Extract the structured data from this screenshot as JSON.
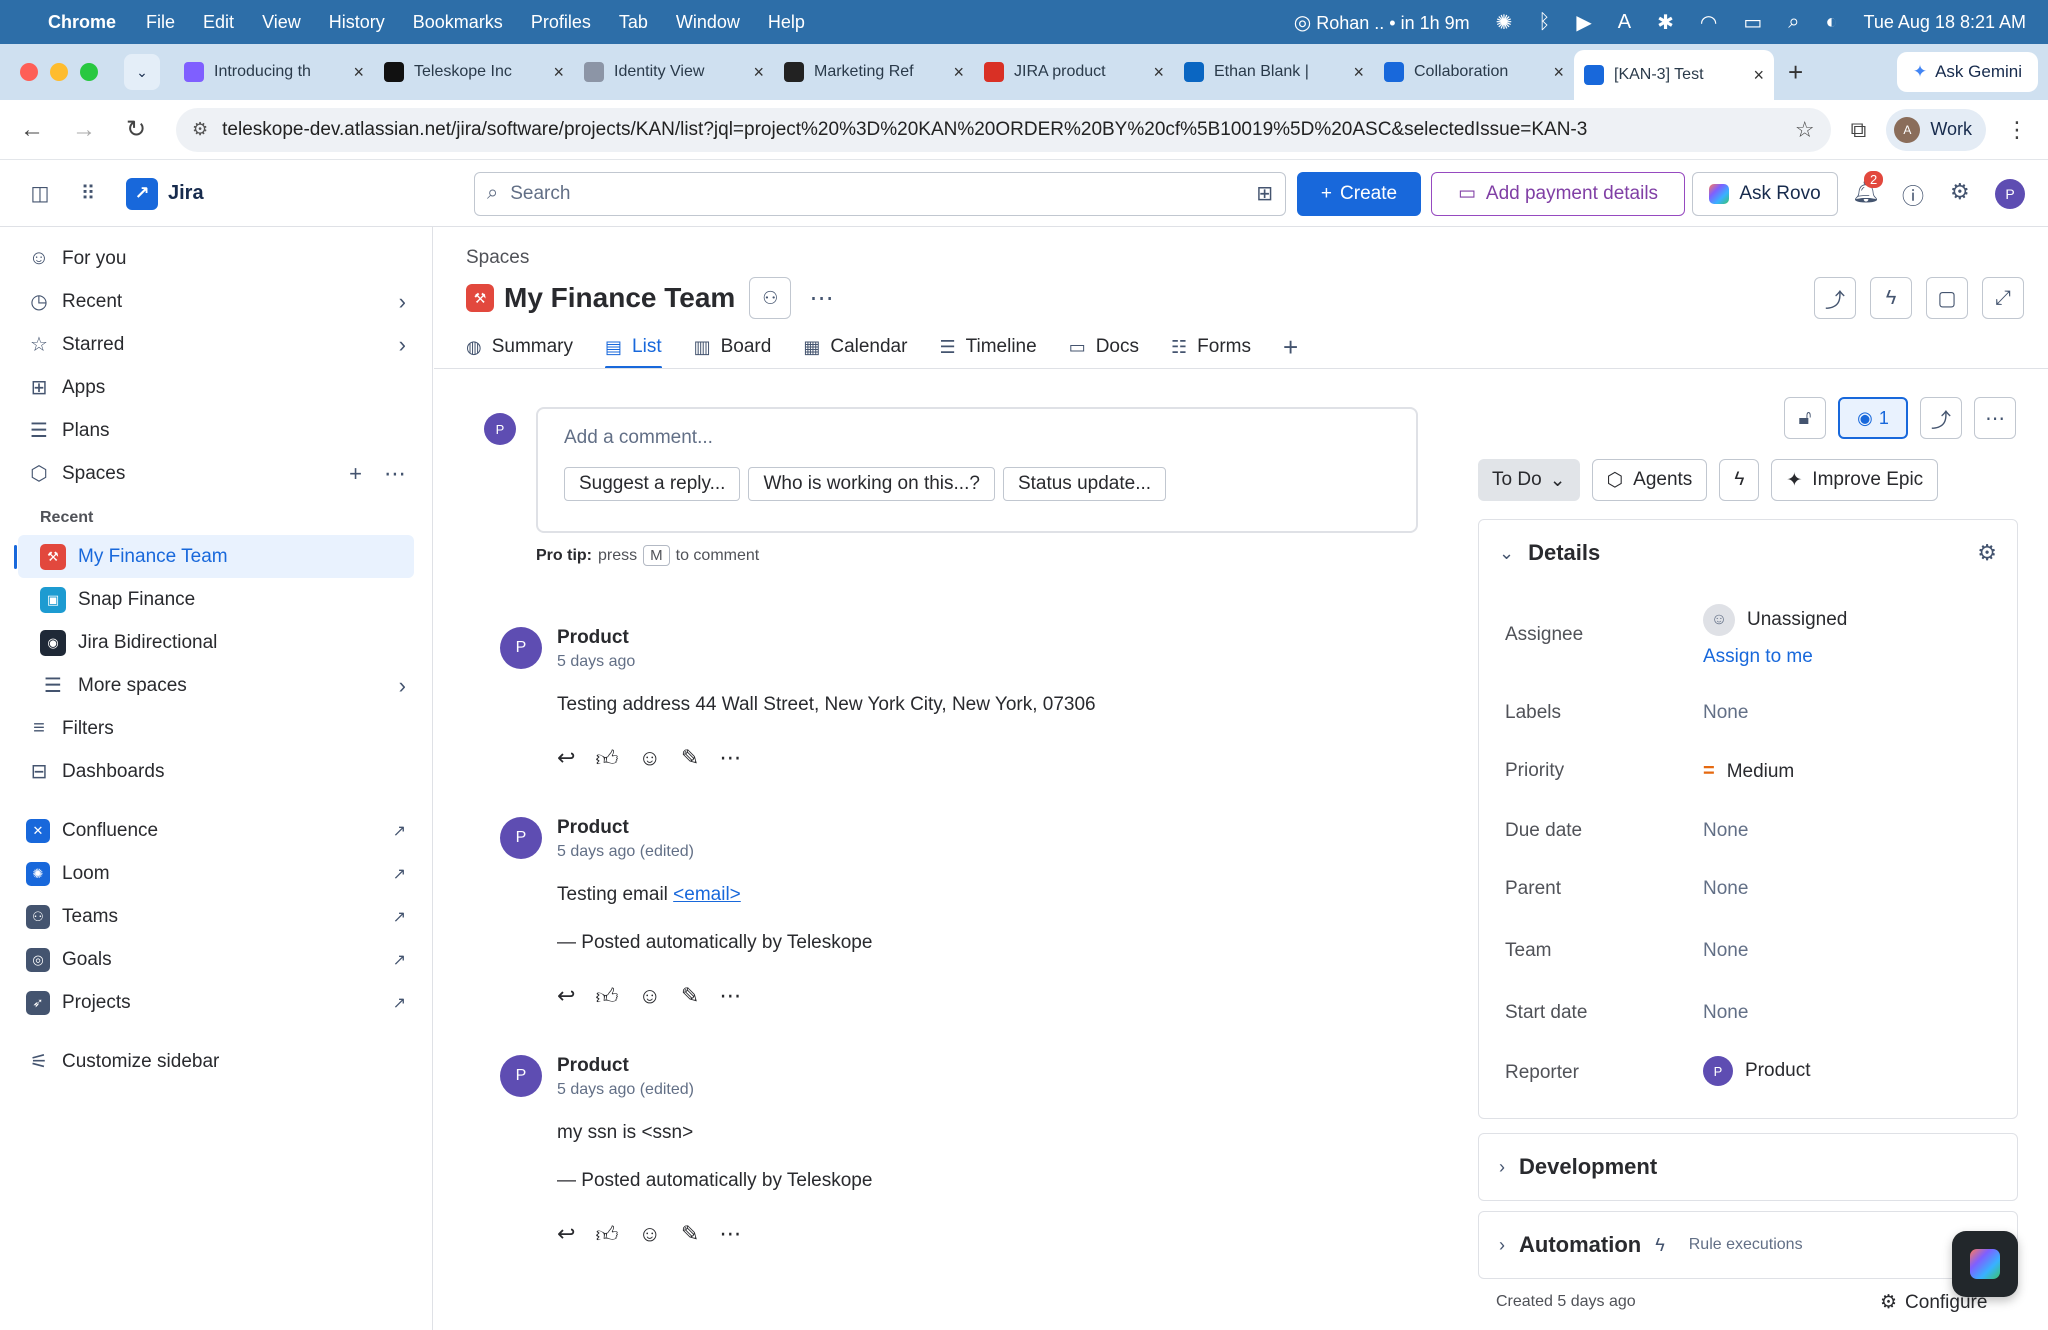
{
  "menubar": {
    "app": "Chrome",
    "items": [
      "File",
      "Edit",
      "View",
      "History",
      "Bookmarks",
      "Profiles",
      "Tab",
      "Window",
      "Help"
    ],
    "status": "Rohan .. • in 1h 9m",
    "datetime": "Tue Aug 18  8:21 AM"
  },
  "tabs": [
    {
      "title": "Introducing th",
      "color": "#7f5fff"
    },
    {
      "title": "Teleskope Inc",
      "color": "#111111"
    },
    {
      "title": "Identity View",
      "color": "#8c95a6"
    },
    {
      "title": "Marketing Ref",
      "color": "#222222"
    },
    {
      "title": "JIRA product",
      "color": "#d93025"
    },
    {
      "title": "Ethan Blank |",
      "color": "#0a66c2"
    },
    {
      "title": "Collaboration",
      "color": "#1868db"
    },
    {
      "title": "[KAN-3] Test",
      "color": "#1868db"
    }
  ],
  "ask_gemini": "Ask Gemini",
  "address": {
    "url": "teleskope-dev.atlassian.net/jira/software/projects/KAN/list?jql=project%20%3D%20KAN%20ORDER%20BY%20cf%5B10019%5D%20ASC&selectedIssue=KAN-3",
    "profile_initial": "A",
    "profile_name": "Work"
  },
  "header": {
    "product": "Jira",
    "search_placeholder": "Search",
    "create": "Create",
    "payment": "Add payment details",
    "rovo": "Ask Rovo",
    "notifications": "2",
    "avatar": "P"
  },
  "sidebar": {
    "top": [
      {
        "label": "For you",
        "icon": "☺"
      },
      {
        "label": "Recent",
        "icon": "◷"
      },
      {
        "label": "Starred",
        "icon": "☆"
      },
      {
        "label": "Apps",
        "icon": "⊞"
      },
      {
        "label": "Plans",
        "icon": "☰"
      },
      {
        "label": "Spaces",
        "icon": "⬡"
      }
    ],
    "recent_label": "Recent",
    "projects": [
      {
        "label": "My Finance Team",
        "color": "#e2483d"
      },
      {
        "label": "Snap Finance",
        "color": "#1d9bd1"
      },
      {
        "label": "Jira Bidirectional",
        "color": "#1f2937"
      }
    ],
    "more_spaces": "More spaces",
    "filters": "Filters",
    "dashboards": "Dashboards",
    "apps": [
      {
        "label": "Confluence",
        "color": "#1868db"
      },
      {
        "label": "Loom",
        "color": "#1868db"
      },
      {
        "label": "Teams",
        "color": "#44546f"
      },
      {
        "label": "Goals",
        "color": "#44546f"
      },
      {
        "label": "Projects",
        "color": "#44546f"
      }
    ],
    "customize": "Customize sidebar"
  },
  "main": {
    "breadcrumb": "Spaces",
    "project_title": "My Finance Team",
    "tabs": [
      "Summary",
      "List",
      "Board",
      "Calendar",
      "Timeline",
      "Docs",
      "Forms"
    ],
    "comment_avatar": "P",
    "comment_placeholder": "Add a comment...",
    "quick_replies": [
      "Suggest a reply...",
      "Who is working on this...?",
      "Status update..."
    ],
    "protip_label": "Pro tip:",
    "protip_press": "press",
    "protip_key": "M",
    "protip_suffix": "to comment",
    "comments": [
      {
        "initial": "P",
        "author": "Product",
        "time": "5 days ago",
        "lines": [
          "Testing address 44 Wall Street, New York City, New York, 07306"
        ]
      },
      {
        "initial": "P",
        "author": "Product",
        "time": "5 days ago  (edited)",
        "text_prefix": "Testing email ",
        "link": "<email>",
        "footer": "— Posted automatically by Teleskope"
      },
      {
        "initial": "P",
        "author": "Product",
        "time": "5 days ago  (edited)",
        "lines": [
          "my ssn is <ssn>",
          "— Posted automatically by Teleskope"
        ]
      }
    ]
  },
  "detail": {
    "watch_count": "1",
    "status": "To Do",
    "agents": "Agents",
    "improve": "Improve Epic",
    "details_title": "Details",
    "fields": {
      "assignee_label": "Assignee",
      "assignee_value": "Unassigned",
      "assign_to_me": "Assign to me",
      "labels_label": "Labels",
      "labels_value": "None",
      "priority_label": "Priority",
      "priority_value": "Medium",
      "due_label": "Due date",
      "due_value": "None",
      "parent_label": "Parent",
      "parent_value": "None",
      "team_label": "Team",
      "team_value": "None",
      "start_label": "Start date",
      "start_value": "None",
      "reporter_label": "Reporter",
      "reporter_initial": "P",
      "reporter_value": "Product"
    },
    "development": "Development",
    "automation": "Automation",
    "automation_sub": "Rule executions",
    "created": "Created 5 days ago",
    "configure": "Configure"
  }
}
